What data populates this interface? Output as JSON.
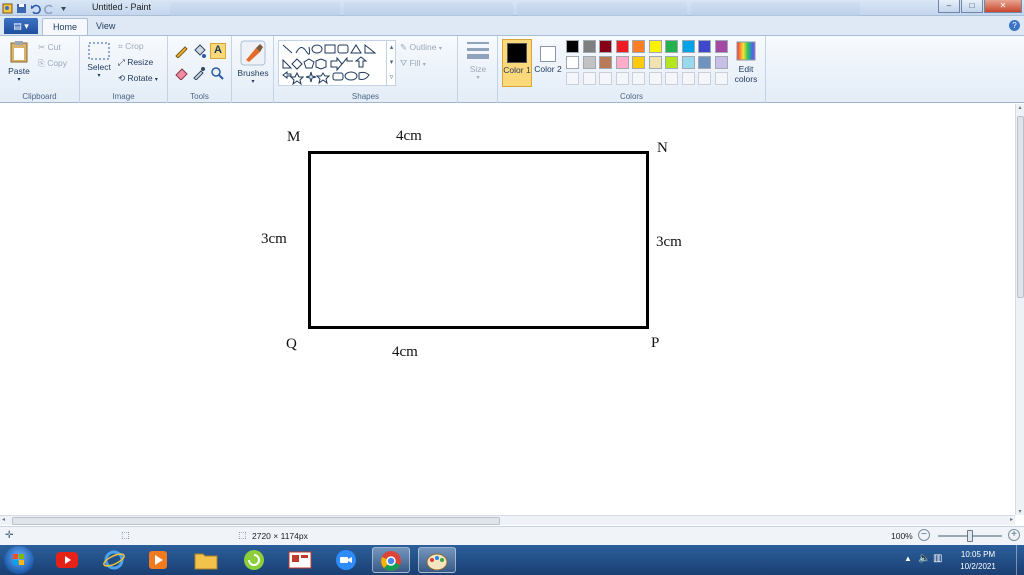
{
  "window": {
    "title": "Untitled - Paint",
    "controls": [
      "minimize",
      "maximize",
      "close"
    ]
  },
  "tabs": {
    "file_label": "▤ ▾",
    "home": "Home",
    "view": "View",
    "help": "?"
  },
  "ribbon": {
    "clipboard": {
      "label": "Clipboard",
      "paste": "Paste",
      "cut": "Cut",
      "copy": "Copy"
    },
    "image": {
      "label": "Image",
      "select": "Select",
      "crop": "Crop",
      "resize": "Resize",
      "rotate": "Rotate"
    },
    "tools": {
      "label": "Tools"
    },
    "brushes": {
      "label": "Brushes"
    },
    "shapes": {
      "label": "Shapes",
      "outline": "Outline",
      "fill": "Fill"
    },
    "size": {
      "label": "Size"
    },
    "colors": {
      "label": "Colors",
      "color1": "Color 1",
      "color1_value": "#000000",
      "color2": "Color 2",
      "color2_value": "#ffffff",
      "edit": "Edit colors",
      "row1": [
        "#000000",
        "#7f7f7f",
        "#880015",
        "#ed1c24",
        "#ff7f27",
        "#fff200",
        "#22b14c",
        "#00a2e8",
        "#3f48cc",
        "#a349a4"
      ],
      "row2": [
        "#ffffff",
        "#c3c3c3",
        "#b97a57",
        "#ffaec9",
        "#ffc90e",
        "#efe4b0",
        "#b5e61d",
        "#99d9ea",
        "#7092be",
        "#c8bfe7"
      ]
    }
  },
  "canvas": {
    "labels": {
      "M": "M",
      "N": "N",
      "P": "P",
      "Q": "Q",
      "top": "4cm",
      "bottom": "4cm",
      "left": "3cm",
      "right": "3cm"
    }
  },
  "status": {
    "image_size": "2720 × 1174px",
    "zoom": "100%",
    "zoom_level": 0.5
  },
  "taskbar": {
    "time": "10:05 PM",
    "date": "10/2/2021",
    "apps": [
      "youtube-icon",
      "internet-explorer-icon",
      "media-player-icon",
      "file-explorer-icon",
      "app-icon",
      "store-icon",
      "zoom-icon",
      "chrome-icon",
      "paint-icon"
    ]
  }
}
